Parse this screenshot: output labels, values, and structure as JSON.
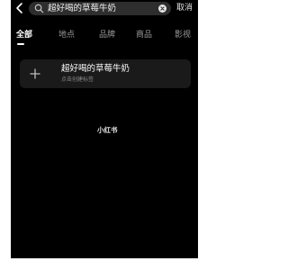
{
  "top_bar": {
    "search_value": "超好喝的草莓牛奶",
    "cancel_label": "取消"
  },
  "tabs": [
    {
      "label": "全部",
      "active": true
    },
    {
      "label": "地点",
      "active": false
    },
    {
      "label": "品牌",
      "active": false
    },
    {
      "label": "商品",
      "active": false
    },
    {
      "label": "影视",
      "active": false
    }
  ],
  "create_card": {
    "title": "超好喝的草莓牛奶",
    "subtitle": "点击创建标签"
  },
  "watermark": "小红书",
  "icons": {
    "back": "chevron-left-icon",
    "search": "search-icon",
    "clear": "clear-icon",
    "add": "plus-icon"
  },
  "colors": {
    "background": "#000000",
    "search_box": "#2e2e2e",
    "card": "#1a1a1a",
    "text_primary": "#ffffff",
    "text_secondary": "#9a9a9a"
  }
}
